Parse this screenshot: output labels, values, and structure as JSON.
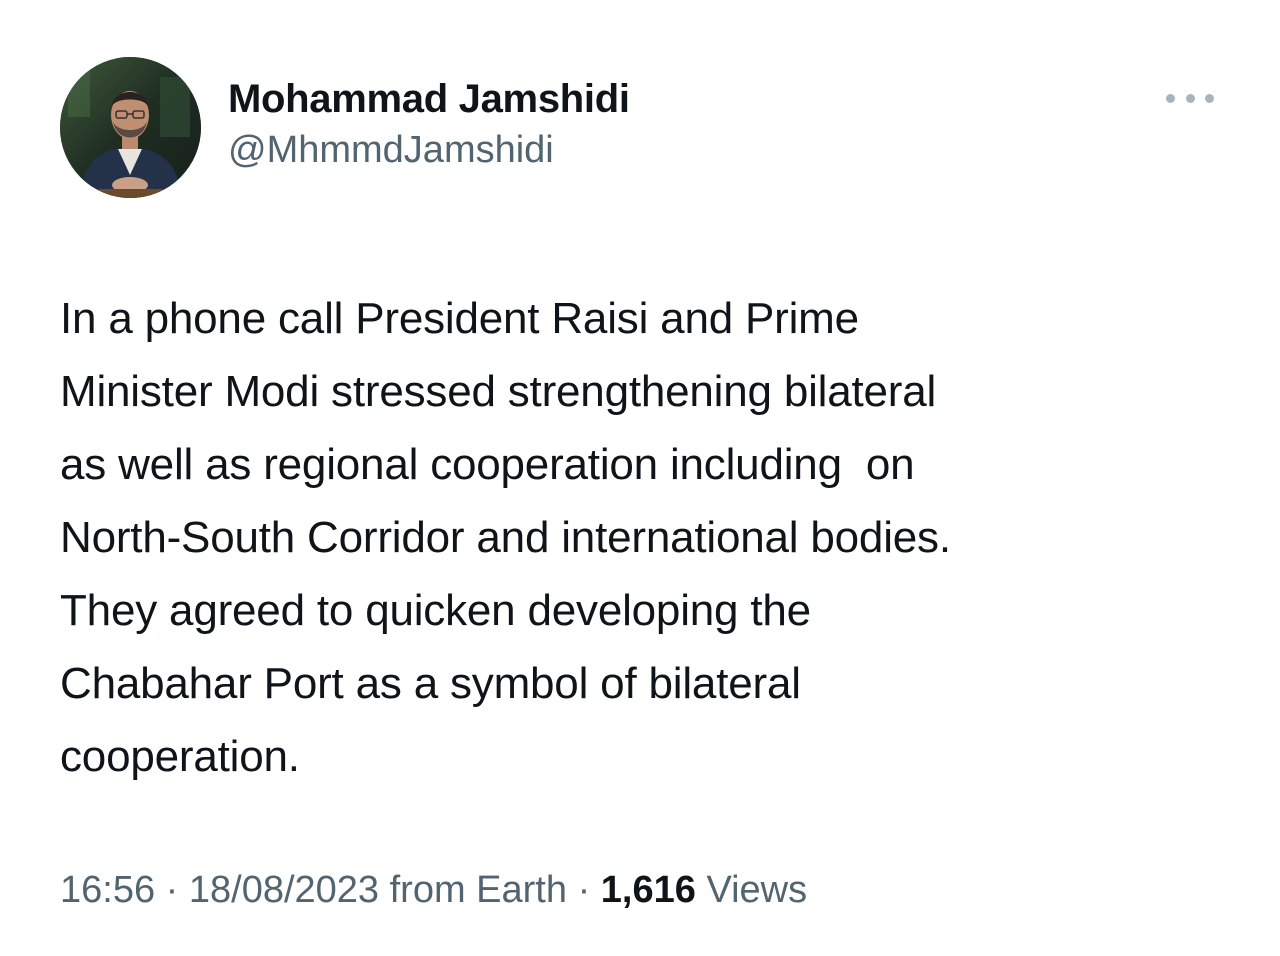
{
  "author": {
    "display_name": "Mohammad Jamshidi",
    "handle": "@MhmmdJamshidi",
    "avatar_icon": "profile-photo"
  },
  "more_icon": "more-horizontal-icon",
  "tweet": {
    "lines": [
      "In a phone call President Raisi and Prime",
      "Minister Modi stressed strengthening bilateral",
      "as well as regional cooperation including  on",
      "North-South Corridor and international bodies.",
      "They agreed to quicken developing the",
      "Chabahar Port as a symbol of bilateral",
      "cooperation."
    ]
  },
  "meta": {
    "time": "16:56",
    "separator": " · ",
    "date": "18/08/2023",
    "source": " from Earth",
    "views_count": "1,616",
    "views_label": " Views"
  },
  "colors": {
    "text": "#0f1419",
    "secondary": "#536471",
    "more_dots": "#a8b3bd"
  }
}
